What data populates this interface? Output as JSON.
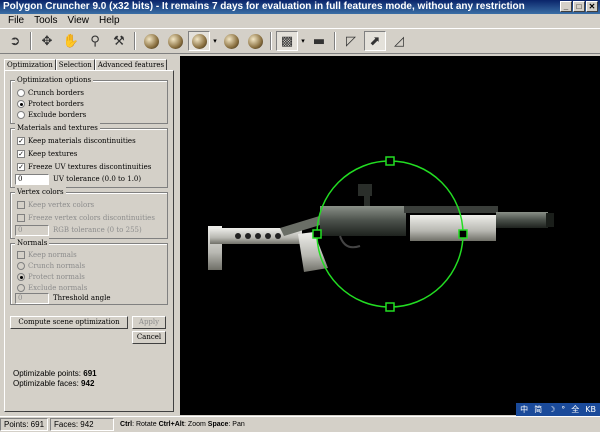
{
  "window": {
    "title": "Polygon Cruncher 9.0 (x32 bits) - It remains 7 days for evaluation in full features mode, without any restriction",
    "buttons": [
      "_",
      "□",
      "✕"
    ]
  },
  "menu": [
    "File",
    "Tools",
    "View",
    "Help"
  ],
  "tabs": [
    "Optimization",
    "Selection",
    "Advanced features"
  ],
  "optimization_options": {
    "title": "Optimization options",
    "items": [
      {
        "label": "Crunch borders",
        "selected": false
      },
      {
        "label": "Protect borders",
        "selected": true
      },
      {
        "label": "Exclude borders",
        "selected": false
      }
    ]
  },
  "materials": {
    "title": "Materials and textures",
    "items": [
      {
        "label": "Keep materials discontinuities",
        "checked": true
      },
      {
        "label": "Keep textures",
        "checked": true
      },
      {
        "label": "Freeze UV textures discontinuities",
        "checked": true
      }
    ],
    "uv_value": "0",
    "uv_label": "UV tolerance (0.0 to 1.0)"
  },
  "vertex_colors": {
    "title": "Vertex colors",
    "items": [
      {
        "label": "Keep vertex colors",
        "checked": false
      },
      {
        "label": "Freeze vertex colors discontinuities",
        "checked": false
      }
    ],
    "rgb_value": "0",
    "rgb_label": "RGB tolerance (0 to 255)"
  },
  "normals": {
    "title": "Normals",
    "keep_label": "Keep normals",
    "items": [
      {
        "label": "Crunch normals",
        "selected": false
      },
      {
        "label": "Protect normals",
        "selected": true
      },
      {
        "label": "Exclude normals",
        "selected": false
      }
    ],
    "threshold_value": "0",
    "threshold_label": "Threshold angle"
  },
  "buttons": {
    "compute": "Compute scene optimization",
    "apply": "Apply",
    "cancel": "Cancel"
  },
  "stats": {
    "points_label": "Optimizable points:",
    "points_value": "691",
    "faces_label": "Optimizable faces:",
    "faces_value": "942"
  },
  "statusbar": {
    "points": "Points: 691",
    "faces": "Faces: 942",
    "help": [
      {
        "key": "Ctrl",
        "text": ": Rotate "
      },
      {
        "key": "Ctrl+Alt",
        "text": ": Zoom "
      },
      {
        "key": "Space",
        "text": ": Pan"
      }
    ]
  },
  "ime": [
    "中",
    "简",
    "☽",
    "°",
    "全",
    "KB"
  ],
  "colors": {
    "gizmo": "#22dd22",
    "viewport_bg": "#000000"
  }
}
